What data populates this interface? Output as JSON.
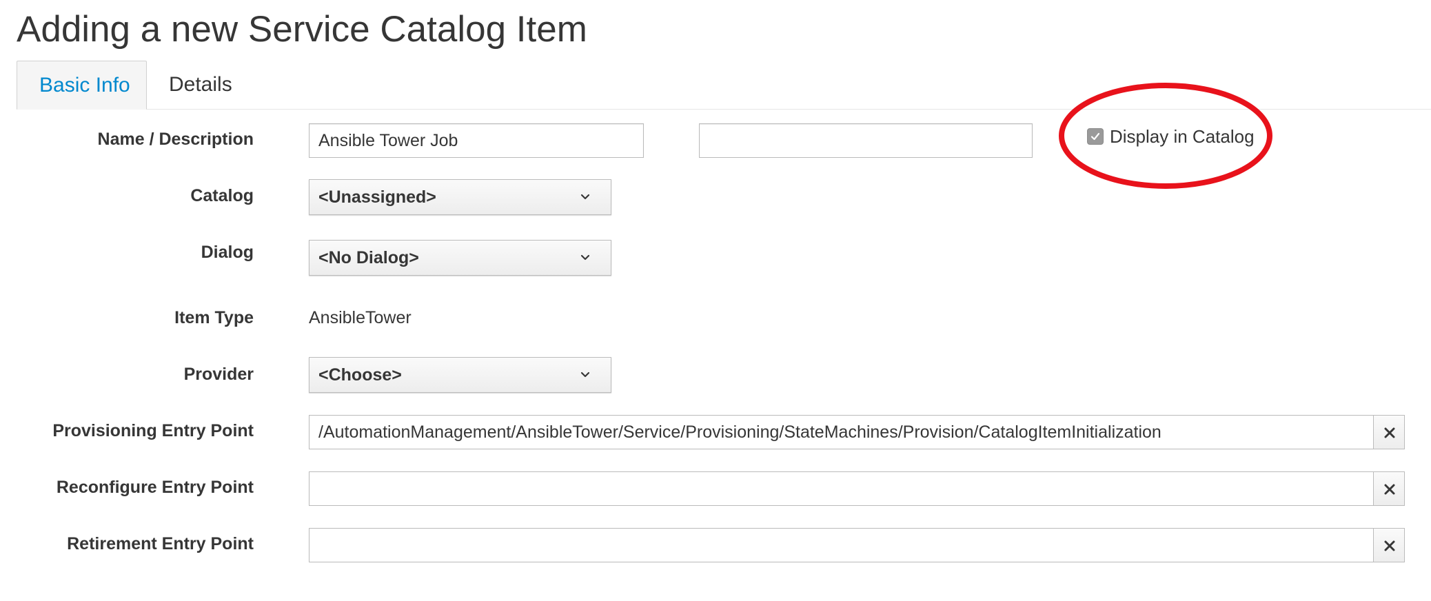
{
  "page": {
    "title": "Adding a new Service Catalog Item"
  },
  "tabs": [
    {
      "label": "Basic Info",
      "active": true
    },
    {
      "label": "Details",
      "active": false
    }
  ],
  "form": {
    "name_description": {
      "label": "Name / Description",
      "name_value": "Ansible Tower Job",
      "description_value": ""
    },
    "display_in_catalog": {
      "label": "Display in Catalog",
      "checked": true
    },
    "catalog": {
      "label": "Catalog",
      "selected": "<Unassigned>"
    },
    "dialog": {
      "label": "Dialog",
      "selected": "<No Dialog>"
    },
    "item_type": {
      "label": "Item Type",
      "value": "AnsibleTower"
    },
    "provider": {
      "label": "Provider",
      "selected": "<Choose>"
    },
    "provisioning_entry_point": {
      "label": "Provisioning Entry Point",
      "value": "/AutomationManagement/AnsibleTower/Service/Provisioning/StateMachines/Provision/CatalogItemInitialization"
    },
    "reconfigure_entry_point": {
      "label": "Reconfigure Entry Point",
      "value": ""
    },
    "retirement_entry_point": {
      "label": "Retirement Entry Point",
      "value": ""
    }
  },
  "icons": {
    "select_arrow": "chevron-down-icon",
    "clear": "close-icon",
    "check": "checkmark-icon"
  },
  "colors": {
    "tab_active_text": "#0088ce",
    "annotation": "#e8121b",
    "text": "#363636"
  }
}
